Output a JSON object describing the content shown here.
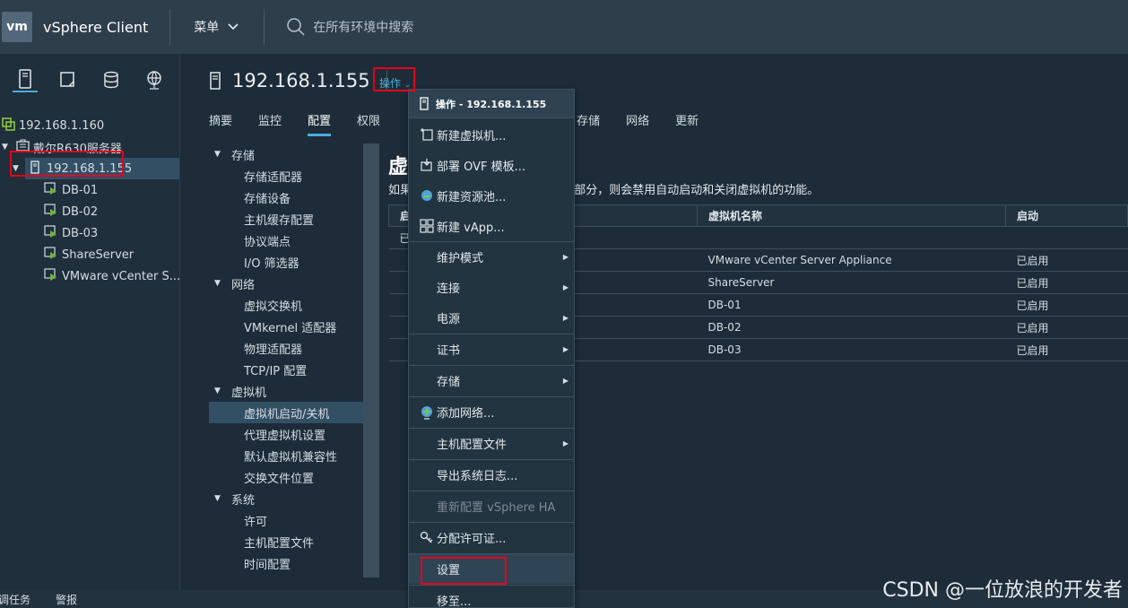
{
  "header": {
    "logo": "vm",
    "app_title": "vSphere Client",
    "menu_label": "菜单",
    "search_placeholder": "在所有环境中搜索"
  },
  "navigator": {
    "icons": [
      "hosts-clusters-icon",
      "vms-templates-icon",
      "storage-icon",
      "networking-icon"
    ],
    "tree": [
      {
        "label": "192.168.1.160",
        "type": "vcenter"
      },
      {
        "label": "戴尔R630服务器",
        "type": "datacenter"
      },
      {
        "label": "192.168.1.155",
        "type": "host",
        "selected": true
      },
      {
        "label": "DB-01",
        "type": "vm"
      },
      {
        "label": "DB-02",
        "type": "vm"
      },
      {
        "label": "DB-03",
        "type": "vm"
      },
      {
        "label": "ShareServer",
        "type": "vm"
      },
      {
        "label": "VMware vCenter S...",
        "type": "vm"
      }
    ]
  },
  "object": {
    "title": "192.168.1.155",
    "actions_label": "操作"
  },
  "tabs": [
    {
      "label": "摘要"
    },
    {
      "label": "监控"
    },
    {
      "label": "配置",
      "active": true
    },
    {
      "label": "权限"
    },
    {
      "label": "存储"
    },
    {
      "label": "网络"
    },
    {
      "label": "更新"
    }
  ],
  "config_nav": {
    "groups": [
      {
        "label": "存储",
        "items": [
          "存储适配器",
          "存储设备",
          "主机缓存配置",
          "协议端点",
          "I/O 筛选器"
        ]
      },
      {
        "label": "网络",
        "items": [
          "虚拟交换机",
          "VMkernel 适配器",
          "物理适配器",
          "TCP/IP 配置"
        ]
      },
      {
        "label": "虚拟机",
        "items": [
          "虚拟机启动/关机",
          "代理虚拟机设置",
          "默认虚拟机兼容性",
          "交换文件位置"
        ]
      },
      {
        "label": "系统",
        "items": [
          "许可",
          "主机配置文件",
          "时间配置"
        ]
      }
    ],
    "selected": "虚拟机启动/关机"
  },
  "main": {
    "heading": "虚",
    "desc_prefix": "如果",
    "desc_suffix": "一部分，则会禁用自动启动和关闭虚拟机的功能。",
    "table": {
      "headers": [
        "启",
        "虚拟机名称",
        "启动"
      ],
      "group_row": "已",
      "rows": [
        {
          "name": "VMware vCenter Server Appliance",
          "status": "已启用"
        },
        {
          "name": "ShareServer",
          "status": "已启用"
        },
        {
          "name": "DB-01",
          "status": "已启用"
        },
        {
          "name": "DB-02",
          "status": "已启用"
        },
        {
          "name": "DB-03",
          "status": "已启用"
        }
      ]
    }
  },
  "dropdown": {
    "title": "操作 - 192.168.1.155",
    "items": [
      {
        "label": "新建虚拟机...",
        "icon": "new-vm-icon"
      },
      {
        "label": "部署 OVF 模板...",
        "icon": "deploy-ovf-icon"
      },
      {
        "label": "新建资源池...",
        "icon": "resource-pool-icon"
      },
      {
        "label": "新建 vApp...",
        "icon": "vapp-icon"
      },
      {
        "label": "维护模式",
        "submenu": true
      },
      {
        "label": "连接",
        "submenu": true
      },
      {
        "label": "电源",
        "submenu": true
      },
      {
        "label": "证书",
        "submenu": true
      },
      {
        "label": "存储",
        "submenu": true
      },
      {
        "label": "添加网络...",
        "icon": "add-network-icon"
      },
      {
        "label": "主机配置文件",
        "submenu": true
      },
      {
        "label": "导出系统日志..."
      },
      {
        "label": "重新配置 vSphere HA",
        "disabled": true
      },
      {
        "label": "分配许可证...",
        "icon": "license-icon"
      },
      {
        "label": "设置",
        "highlight": true
      },
      {
        "label": "移至..."
      }
    ]
  },
  "bottom": {
    "tasks": "调任务",
    "alarms": "警报"
  },
  "watermark": "CSDN @一位放浪的开发者",
  "colors": {
    "accent": "#49afd9",
    "highlight_box": "#e5001d",
    "vm_green": "#6db33f"
  }
}
